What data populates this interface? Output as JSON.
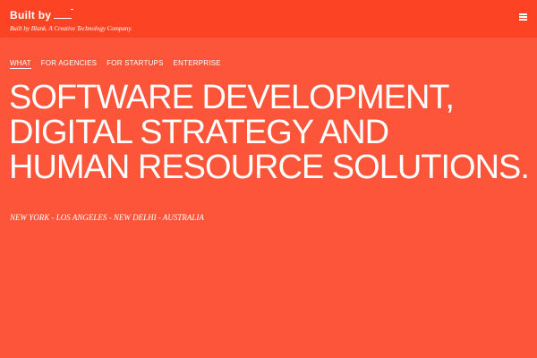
{
  "header": {
    "logo_text": "Built by",
    "tagline": "Built by Blank.  A Creative Technology Company.",
    "menu_icon": "hamburger-icon"
  },
  "nav": {
    "items": [
      {
        "label": "WHAT",
        "active": true
      },
      {
        "label": "FOR AGENCIES"
      },
      {
        "label": "FOR STARTUPS"
      },
      {
        "label": "ENTERPRISE"
      }
    ]
  },
  "hero": {
    "lines": [
      "SOFTWARE DEVELOPMENT,",
      "DIGITAL STRATEGY AND",
      "HUMAN RESOURCE SOLUTIONS."
    ],
    "locations": "NEW YORK - LOS ANGELES - NEW DELHI - AUSTRALIA"
  },
  "colors": {
    "header_bg": "#fc4424",
    "page_bg": "#fd5539",
    "text": "#ffffff"
  }
}
